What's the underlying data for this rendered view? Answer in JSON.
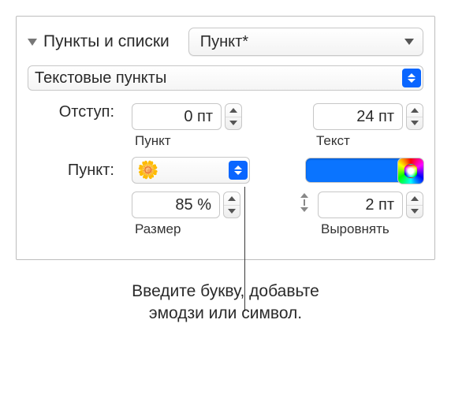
{
  "section": {
    "title": "Пункты и списки",
    "style": "Пункт*"
  },
  "bullet_type": "Текстовые пункты",
  "indent": {
    "label": "Отступ:",
    "bullet_value": "0 пт",
    "bullet_sub": "Пункт",
    "text_value": "24 пт",
    "text_sub": "Текст"
  },
  "bullet": {
    "label": "Пункт:",
    "char": "🌼",
    "color": "#0a74ff"
  },
  "size": {
    "value": "85 %",
    "sub": "Размер"
  },
  "align": {
    "value": "2 пт",
    "sub": "Выровнять"
  },
  "callout": {
    "line1": "Введите букву, добавьте",
    "line2": "эмодзи или символ."
  }
}
